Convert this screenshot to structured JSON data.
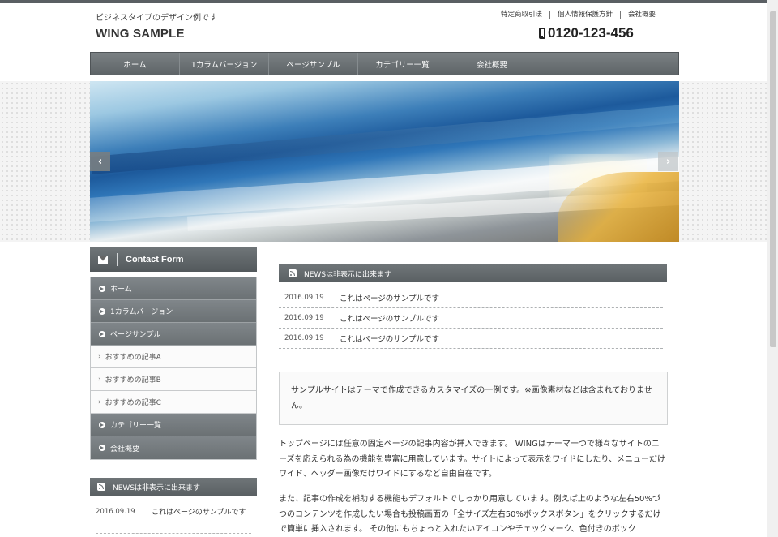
{
  "header": {
    "tagline": "ビジネスタイプのデザイン例です",
    "logo": "WING SAMPLE",
    "top_links": [
      "特定商取引法",
      "個人情報保護方針",
      "会社概要"
    ],
    "phone": "0120-123-456",
    "phone_icon": "mobile-phone-icon"
  },
  "global_nav": {
    "items": [
      "ホーム",
      "1カラムバージョン",
      "ページサンプル",
      "カテゴリー一覧",
      "会社概要"
    ]
  },
  "slider": {
    "prev_glyph": "‹",
    "next_glyph": "›"
  },
  "sidebar": {
    "contact_label": "Contact Form",
    "nav": [
      {
        "label": "ホーム",
        "level": "main"
      },
      {
        "label": "1カラムバージョン",
        "level": "main"
      },
      {
        "label": "ページサンプル",
        "level": "main"
      },
      {
        "label": "おすすめの記事A",
        "level": "sub"
      },
      {
        "label": "おすすめの記事B",
        "level": "sub"
      },
      {
        "label": "おすすめの記事C",
        "level": "sub"
      },
      {
        "label": "カテゴリー一覧",
        "level": "main"
      },
      {
        "label": "会社概要",
        "level": "main"
      }
    ],
    "sub_chevron": "›",
    "news_heading": "NEWSは非表示に出来ます",
    "news": [
      {
        "date": "2016.09.19",
        "title": "これはページのサンプルです"
      }
    ]
  },
  "main": {
    "news_heading": "NEWSは非表示に出来ます",
    "news": [
      {
        "date": "2016.09.19",
        "title": "これはページのサンプルです"
      },
      {
        "date": "2016.09.19",
        "title": "これはページのサンプルです"
      },
      {
        "date": "2016.09.19",
        "title": "これはページのサンプルです"
      }
    ],
    "notice": "サンプルサイトはテーマで作成できるカスタマイズの一例です。※画像素材などは含まれておりません。",
    "paragraphs": [
      "トップページには任意の固定ページの記事内容が挿入できます。 WINGはテーマ一つで様々なサイトのニーズを応えられる為の機能を豊富に用意しています。サイトによって表示をワイドにしたり、メニューだけワイド、ヘッダー画像だけワイドにするなど自由自在です。",
      "また、記事の作成を補助する機能もデフォルトでしっかり用意しています。例えば上のような左右50%づつのコンテンツを作成したい場合も投稿画面の「全サイズ左右50%ボックスボタン」をクリックするだけで簡単に挿入されます。 その他にもちょっと入れたいアイコンやチェックマーク、色付きのボック"
    ]
  },
  "colors": {
    "nav_bg": "#6b7174",
    "accent_dark": "#5a5f63"
  }
}
